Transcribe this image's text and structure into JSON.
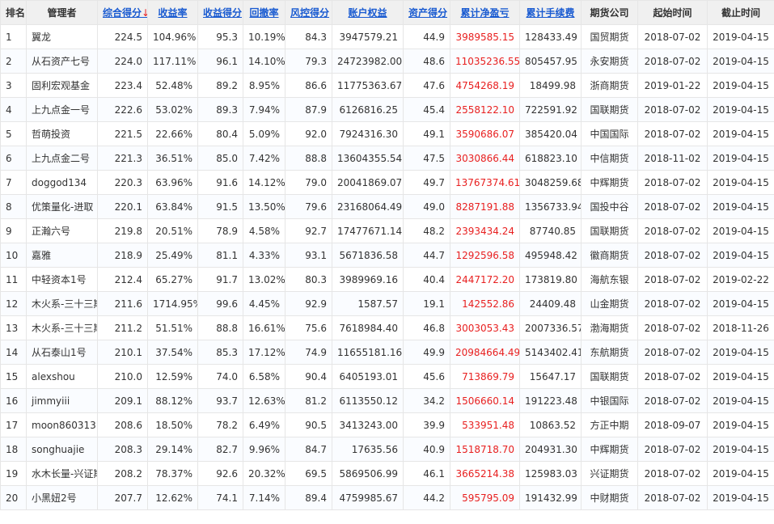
{
  "headers": {
    "rank": "排名",
    "manager": "管理者",
    "total_score": "综合得分",
    "sort_arrow": "↓",
    "return_rate": "收益率",
    "return_score": "收益得分",
    "drawdown": "回撤率",
    "risk_score": "风控得分",
    "equity": "账户权益",
    "asset_score": "资产得分",
    "net_profit": "累计净盈亏",
    "fees": "累计手续费",
    "company": "期货公司",
    "start": "起始时间",
    "end": "截止时间"
  },
  "rows": [
    [
      "1",
      "翼龙",
      "224.5",
      "104.96%",
      "95.3",
      "10.19%",
      "84.3",
      "3947579.21",
      "44.9",
      "3989585.15",
      "128433.49",
      "国贸期货",
      "2018-07-02",
      "2019-04-15"
    ],
    [
      "2",
      "从石资产七号",
      "224.0",
      "117.11%",
      "96.1",
      "14.10%",
      "79.3",
      "24723982.00",
      "48.6",
      "11035236.55",
      "805457.95",
      "永安期货",
      "2018-07-02",
      "2019-04-15"
    ],
    [
      "3",
      "固利宏观基金",
      "223.4",
      "52.48%",
      "89.2",
      "8.95%",
      "86.6",
      "11775363.67",
      "47.6",
      "4754268.19",
      "18499.98",
      "浙商期货",
      "2019-01-22",
      "2019-04-15"
    ],
    [
      "4",
      "上九点金一号",
      "222.6",
      "53.02%",
      "89.3",
      "7.94%",
      "87.9",
      "6126816.25",
      "45.4",
      "2558122.10",
      "722591.92",
      "国联期货",
      "2018-07-02",
      "2019-04-15"
    ],
    [
      "5",
      "哲萌投资",
      "221.5",
      "22.66%",
      "80.4",
      "5.09%",
      "92.0",
      "7924316.30",
      "49.1",
      "3590686.07",
      "385420.04",
      "中国国际",
      "2018-07-02",
      "2019-04-15"
    ],
    [
      "6",
      "上九点金二号",
      "221.3",
      "36.51%",
      "85.0",
      "7.42%",
      "88.8",
      "13604355.54",
      "47.5",
      "3030866.44",
      "618823.10",
      "中信期货",
      "2018-11-02",
      "2019-04-15"
    ],
    [
      "7",
      "doggod134",
      "220.3",
      "63.96%",
      "91.6",
      "14.12%",
      "79.0",
      "20041869.07",
      "49.7",
      "13767374.61",
      "3048259.68",
      "中辉期货",
      "2018-07-02",
      "2019-04-15"
    ],
    [
      "8",
      "优策量化-进取",
      "220.1",
      "63.84%",
      "91.5",
      "13.50%",
      "79.6",
      "23168064.49",
      "49.0",
      "8287191.88",
      "1356733.94",
      "国投中谷",
      "2018-07-02",
      "2019-04-15"
    ],
    [
      "9",
      "正瀚六号",
      "219.8",
      "20.51%",
      "78.9",
      "4.58%",
      "92.7",
      "17477671.14",
      "48.2",
      "2393434.24",
      "87740.85",
      "国联期货",
      "2018-07-02",
      "2019-04-15"
    ],
    [
      "10",
      "嘉雅",
      "218.9",
      "25.49%",
      "81.1",
      "4.33%",
      "93.1",
      "5671836.58",
      "44.7",
      "1292596.58",
      "495948.42",
      "徽商期货",
      "2018-07-02",
      "2019-04-15"
    ],
    [
      "11",
      "中轻资本1号",
      "212.4",
      "65.27%",
      "91.7",
      "13.02%",
      "80.3",
      "3989969.16",
      "40.4",
      "2447172.20",
      "173819.80",
      "海航东银",
      "2018-07-02",
      "2019-02-22"
    ],
    [
      "12",
      "木火系-三十三期",
      "211.6",
      "1714.95%",
      "99.6",
      "4.45%",
      "92.9",
      "1587.57",
      "19.1",
      "142552.86",
      "24409.48",
      "山金期货",
      "2018-07-02",
      "2019-04-15"
    ],
    [
      "13",
      "木火系-三十三期",
      "211.2",
      "51.51%",
      "88.8",
      "16.61%",
      "75.6",
      "7618984.40",
      "46.8",
      "3003053.43",
      "2007336.57",
      "渤海期货",
      "2018-07-02",
      "2018-11-26"
    ],
    [
      "14",
      "从石泰山1号",
      "210.1",
      "37.54%",
      "85.3",
      "17.12%",
      "74.9",
      "11655181.16",
      "49.9",
      "20984664.49",
      "5143402.41",
      "东航期货",
      "2018-07-02",
      "2019-04-15"
    ],
    [
      "15",
      "alexshou",
      "210.0",
      "12.59%",
      "74.0",
      "6.58%",
      "90.4",
      "6405193.01",
      "45.6",
      "713869.79",
      "15647.17",
      "国联期货",
      "2018-07-02",
      "2019-04-15"
    ],
    [
      "16",
      "jimmyiii",
      "209.1",
      "88.12%",
      "93.7",
      "12.63%",
      "81.2",
      "6113550.12",
      "34.2",
      "1506660.14",
      "191223.48",
      "中银国际",
      "2018-07-02",
      "2019-04-15"
    ],
    [
      "17",
      "moon860313",
      "208.6",
      "18.50%",
      "78.2",
      "6.49%",
      "90.5",
      "3413243.00",
      "39.9",
      "533951.48",
      "10863.52",
      "方正中期",
      "2018-09-07",
      "2019-04-15"
    ],
    [
      "18",
      "songhuajie",
      "208.3",
      "29.14%",
      "82.7",
      "9.96%",
      "84.7",
      "17635.56",
      "40.9",
      "1518718.70",
      "204931.30",
      "中辉期货",
      "2018-07-02",
      "2019-04-15"
    ],
    [
      "19",
      "水木长量-兴证期货",
      "208.2",
      "78.37%",
      "92.6",
      "20.32%",
      "69.5",
      "5869506.99",
      "46.1",
      "3665214.38",
      "125983.03",
      "兴证期货",
      "2018-07-02",
      "2019-04-15"
    ],
    [
      "20",
      "小黑妞2号",
      "207.7",
      "12.62%",
      "74.1",
      "7.14%",
      "89.4",
      "4759985.67",
      "44.2",
      "595795.09",
      "191432.99",
      "中财期货",
      "2018-07-02",
      "2019-04-15"
    ]
  ]
}
